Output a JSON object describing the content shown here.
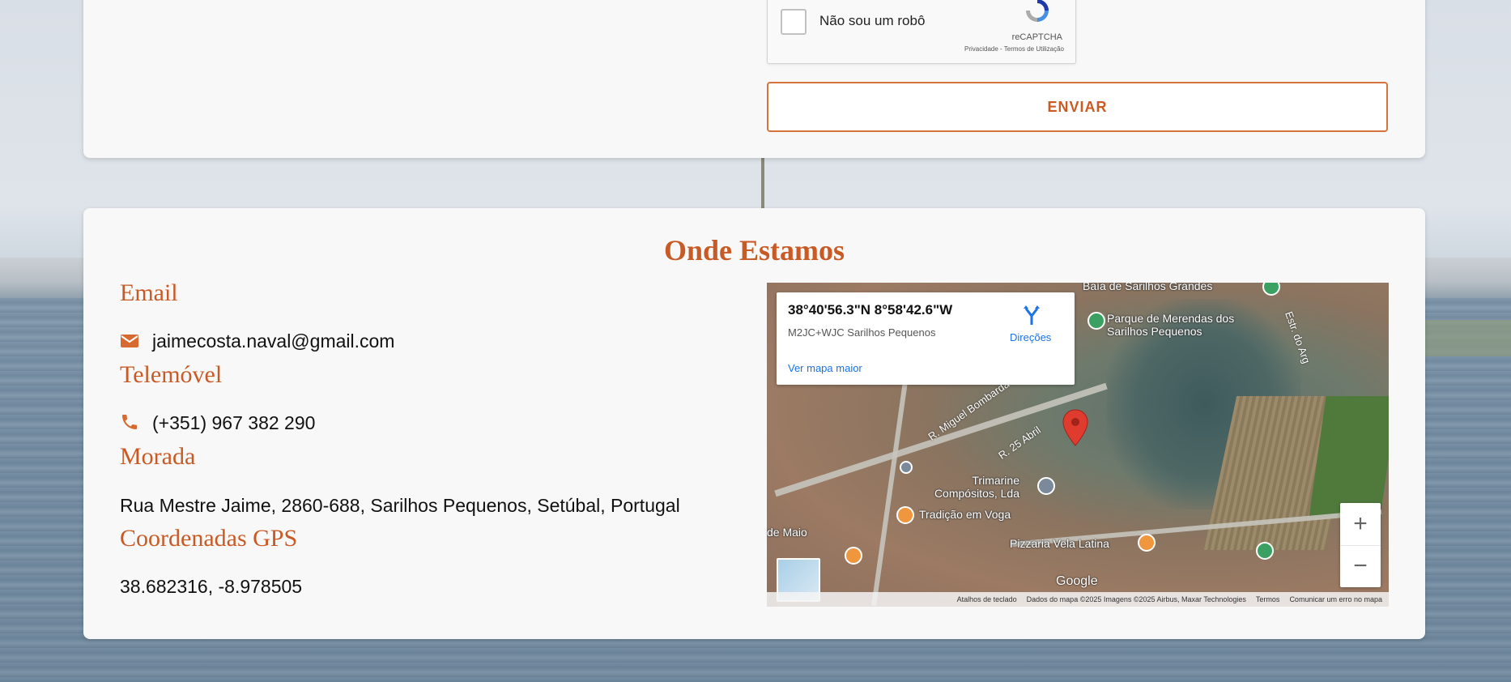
{
  "form": {
    "recaptcha_label": "Não sou um robô",
    "recaptcha_brand": "reCAPTCHA",
    "recaptcha_terms": "Privacidade - Termos de Utilização",
    "submit_label": "ENVIAR"
  },
  "location": {
    "title": "Onde Estamos",
    "email_label": "Email",
    "email_value": "jaimecosta.naval@gmail.com",
    "phone_label": "Telemóvel",
    "phone_value": "(+351) 967 382 290",
    "address_label": "Morada",
    "address_value": "Rua Mestre Jaime, 2860-688, Sarilhos Pequenos, Setúbal, Portugal",
    "gps_label": "Coordenadas GPS",
    "gps_value": "38.682316, -8.978505"
  },
  "map": {
    "info_coords": "38°40'56.3\"N 8°58'42.6\"W",
    "info_pluscode": "M2JC+WJC Sarilhos Pequenos",
    "directions_label": "Direções",
    "larger_map_link": "Ver mapa maior",
    "places": {
      "bay": "Baía de Sarilhos Grandes",
      "park": "Parque de Merendas dos Sarilhos Pequenos",
      "road_estr": "Estr. do Arg",
      "road_miguel": "R. Miguel Bombarda",
      "road_25abril": "R. 25 Abril",
      "trimarine": "Trimarine Compósitos, Lda",
      "tradicao": "Tradição em Voga",
      "pizzaria": "Pizzaria Vela Latina",
      "de_maio": "de Maio"
    },
    "google": "Google",
    "footer": {
      "shortcuts": "Atalhos de teclado",
      "data": "Dados do mapa ©2025 Imagens ©2025 Airbus, Maxar Technologies",
      "terms": "Termos",
      "report": "Comunicar um erro no mapa"
    },
    "zoom_in": "+",
    "zoom_out": "−"
  },
  "colors": {
    "accent": "#c85a25",
    "button_border": "#d8733c"
  },
  "icons": {
    "email": "envelope-icon",
    "phone": "phone-icon",
    "directions": "directions-icon",
    "pin": "map-pin-icon",
    "recaptcha": "recaptcha-logo-icon"
  }
}
